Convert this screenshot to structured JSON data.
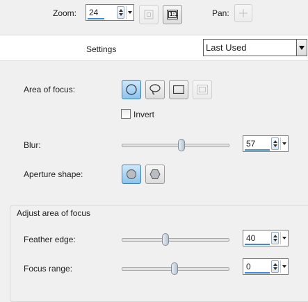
{
  "toolbar": {
    "zoom_label": "Zoom:",
    "zoom_value": "24",
    "pan_label": "Pan:",
    "fit_icon": "fit-to-window-icon",
    "actual_size_label": "1:1",
    "pan_icon": "move-crosshair-icon"
  },
  "settings": {
    "label": "Settings",
    "preset_value": "Last Used"
  },
  "area_of_focus": {
    "label": "Area of focus:",
    "shapes": [
      "ellipse",
      "lasso",
      "rectangle",
      "full-frame"
    ],
    "selected": "ellipse",
    "invert_label": "Invert",
    "invert_checked": false
  },
  "blur": {
    "label": "Blur:",
    "value": "57",
    "slider_fraction": 0.57
  },
  "aperture": {
    "label": "Aperture shape:",
    "options": [
      "circle",
      "hexagon"
    ],
    "selected": "circle"
  },
  "adjust": {
    "group_title": "Adjust area of focus",
    "feather_label": "Feather edge:",
    "feather_value": "40",
    "feather_fraction": 0.4,
    "range_label": "Focus range:",
    "range_value": "0",
    "range_fraction": 0.5
  },
  "colors": {
    "accent": "#3a8be0",
    "selected_button": "#8cc4ee"
  }
}
